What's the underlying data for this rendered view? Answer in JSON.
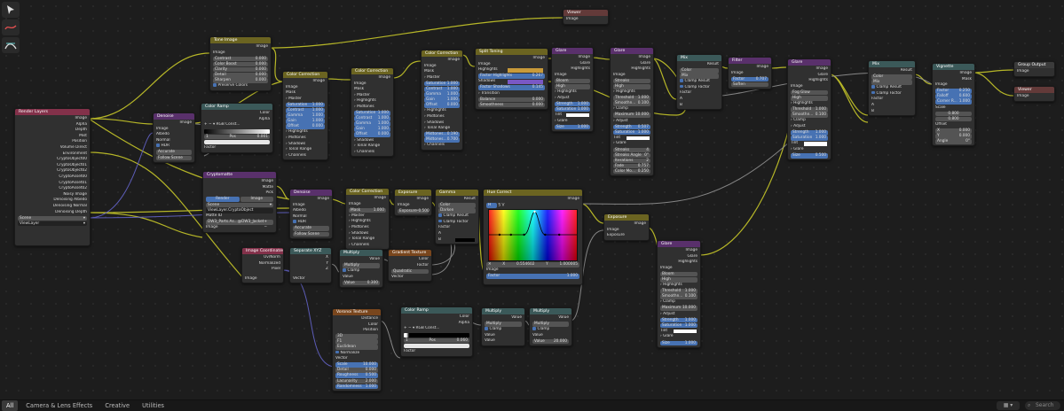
{
  "statusbar": {
    "tabs": [
      "All",
      "Camera & Lens Effects",
      "Creative",
      "Utilities"
    ],
    "layout_icon": "grid-icon",
    "search_placeholder": "Search"
  },
  "toolbar": {
    "icons": [
      "select-icon",
      "annotate-icon",
      "pan-icon"
    ]
  },
  "nodes": {
    "viewer_top": {
      "title": "Viewer",
      "image": "Image"
    },
    "tone_image": {
      "title": "Tone Image",
      "out": "Image",
      "in_image": "Image",
      "f1": "Contrast",
      "v1": "0.000",
      "f2": "Color Boost",
      "v2": "0.000",
      "f3": "Clarity",
      "v3": "0.000",
      "f4": "Detail",
      "v4": "0.000",
      "f5": "Sharpen",
      "v5": "0.000",
      "preserve": "Preserve Colors"
    },
    "render_layers": {
      "title": "Render Layers",
      "outputs": [
        "Image",
        "Alpha",
        "Depth",
        "Mist",
        "Position",
        "Volume Direct",
        "Environment",
        "CryptoObject00",
        "CryptoObject01",
        "CryptoObject02",
        "CryptoAsset00",
        "CryptoAsset01",
        "CryptoAsset02",
        "Noisy Image",
        "Denoising Albedo",
        "Denoising Normal",
        "Denoising Depth"
      ],
      "scene": "Scene",
      "viewlayer": "ViewLayer"
    },
    "denoise1": {
      "title": "Denoise",
      "out": "Image",
      "i1": "Image",
      "i2": "Albedo",
      "i3": "Normal",
      "hdr": "HDR",
      "mode": "Accurate",
      "follow": "Follow Scene"
    },
    "color_ramp1": {
      "title": "Color Ramp",
      "o1": "Color",
      "o2": "Alpha",
      "mode": "RGB",
      "interp": "Const...",
      "stop": "1",
      "pos_label": "Pos",
      "pos": "0.001",
      "factor": "Factor"
    },
    "cc1": {
      "title": "Color Correction",
      "out": "Image",
      "i1": "Image",
      "i2": "Mask",
      "master": "Master",
      "sat": "Saturation",
      "sat_v": "1.000",
      "con": "Contrast",
      "con_v": "1.000",
      "gam": "Gamma",
      "gam_v": "1.000",
      "gain": "Gain",
      "gain_v": "1.000",
      "off": "Offset",
      "off_v": "0.000",
      "subs": [
        "Highlights",
        "Midtones",
        "Shadows",
        "Tonal Range",
        "Channels"
      ]
    },
    "cc2": {
      "title": "Color Correction",
      "out": "Image",
      "i1": "Image",
      "i2": "Mask",
      "subs": [
        "Master",
        "Highlights",
        "Midtones"
      ],
      "sat": "Saturation",
      "sat_v": "1.000",
      "con": "Contrast",
      "con_v": "1.000",
      "gam": "Gamma",
      "gam_v": "1.000",
      "gain": "Gain",
      "gain_v": "1.000",
      "off": "Offset",
      "off_v": "0.000",
      "subs2": [
        "Shadows",
        "Tonal Range",
        "Channels"
      ]
    },
    "cc3": {
      "title": "Color Correction",
      "out": "Image",
      "i1": "Image",
      "i2": "Mask",
      "master": "Master",
      "sat": "Saturation",
      "sat_v": "1.000",
      "con": "Contrast",
      "con_v": "1.000",
      "gam": "Gamma",
      "gam_v": "1.000",
      "gain": "Gain",
      "gain_v": "1.000",
      "off": "Offset",
      "off_v": "0.000",
      "subs": [
        "Highlights",
        "Midtones",
        "Shadows",
        "Tonal Range"
      ],
      "mid": "Midtones...",
      "mid_v": "0.190",
      "mid2": "Midtones...",
      "mid2_v": "0.700",
      "channels": "Channels"
    },
    "split_toning": {
      "title": "Split Toning",
      "out": "Image",
      "i1": "Image",
      "hl": "Highlights",
      "factor_hl": "Factor Highlights",
      "factor_hl_v": "0.267",
      "sh": "Shadows",
      "factor_sh": "Factor Shadows",
      "factor_sh_v": "0.145",
      "trans": "Transition",
      "bal": "Balance",
      "bal_v": "0.000",
      "smooth": "Smoothness",
      "smooth_v": "0.000"
    },
    "glare1": {
      "title": "Glare",
      "o1": "Image",
      "o2": "Glare",
      "o3": "Highlights",
      "i1": "Image",
      "type": "Bloom",
      "quality": "High",
      "hl": "Highlights",
      "adjust": "Adjust",
      "str": "Strength",
      "str_v": "1.000",
      "sat": "Saturation",
      "sat_v": "1.000",
      "tint": "Tint",
      "glare": "Glare",
      "size": "Size",
      "size_v": "1.000"
    },
    "glare2": {
      "title": "Glare",
      "o1": "Image",
      "o2": "Glare",
      "o3": "Highlights",
      "i1": "Image",
      "type": "Streaks",
      "quality": "High",
      "hl": "Highlights",
      "thr": "Threshold",
      "thr_v": "1.000",
      "smooth": "Smoothn...",
      "smooth_v": "0.100",
      "clamp": "Clamp",
      "max": "Maximum",
      "max_v": "10.000",
      "adjust": "Adjust",
      "str": "Strength",
      "str_v": "0.507",
      "sat": "Saturation",
      "sat_v": "1.000",
      "tint": "Tint",
      "glare": "Glare",
      "streaks": "Streaks",
      "streaks_v": "4",
      "angle": "Streaks Angle",
      "angle_v": "0°",
      "iter": "Iterations",
      "iter_v": "2",
      "fade": "Fade",
      "fade_v": "0.757",
      "color_mod": "Color Mo...",
      "color_mod_v": "0.250"
    },
    "mix1": {
      "title": "Mix",
      "out": "Result",
      "mode": "Color",
      "blend": "Mix",
      "clamp_res": "Clamp Result",
      "clamp_f": "Clamp Factor",
      "factor": "Factor",
      "a": "A",
      "b": "B"
    },
    "filter": {
      "title": "Filter",
      "out": "Image",
      "i1": "Image",
      "factor": "Factor",
      "factor_v": "0.707",
      "type": "Soften"
    },
    "glare3": {
      "title": "Glare",
      "o1": "Image",
      "o2": "Glare",
      "o3": "Highlights",
      "i1": "Image",
      "type": "Fog Glow",
      "quality": "High",
      "hl": "Highlights",
      "thr": "Threshold",
      "thr_v": "1.000",
      "smooth": "Smoothn...",
      "smooth_v": "0.100",
      "clamp": "Clamp",
      "adjust": "Adjust",
      "str": "Strength",
      "str_v": "1.000",
      "sat": "Saturation",
      "sat_v": "1.000",
      "tint": "Tint",
      "glare": "Glare",
      "size": "Size",
      "size_v": "0.500"
    },
    "mix2": {
      "title": "Mix",
      "out": "Result",
      "mode": "Color",
      "blend": "Mix",
      "clamp_res": "Clamp Result",
      "clamp_f": "Clamp Factor",
      "factor": "Factor",
      "a": "A",
      "b": "B"
    },
    "vignette": {
      "title": "Vignette",
      "o1": "Image",
      "o2": "Mask",
      "i1": "Image",
      "factor": "Factor",
      "factor_v": "0.250",
      "falloff": "Falloff",
      "falloff_v": "0.600",
      "corner": "Corner R...",
      "corner_v": "1.000",
      "scale": "Scale",
      "sx": "0.800",
      "sy": "0.800",
      "offset": "Offset",
      "ox": "X",
      "ox_v": "0.000",
      "oy": "Y",
      "oy_v": "0.000",
      "angle": "Angle",
      "angle_v": "0°"
    },
    "group_output": {
      "title": "Group Output",
      "image": "Image"
    },
    "viewer_right": {
      "title": "Viewer",
      "image": "Image"
    },
    "cryptomatte": {
      "title": "Cryptomatte",
      "o1": "Image",
      "o2": "Matte",
      "o3": "Pick",
      "tab1": "Render",
      "tab2": "Image",
      "scene": "Scene",
      "layer": "ViewLayer.CryptoObject",
      "matte_id": "Matte ID",
      "matte_v": "DW3_Parts.As...@DW3_Jacket",
      "in": "Image"
    },
    "denoise2": {
      "title": "Denoise",
      "out": "Image",
      "i1": "Image",
      "i2": "Albedo",
      "i3": "Normal",
      "hdr": "HDR",
      "mode": "Accurate",
      "follow": "Follow Scene"
    },
    "cc4": {
      "title": "Color Correction",
      "out": "Image",
      "i1": "Image",
      "mask": "Mask",
      "mask_v": "1.000",
      "subs": [
        "Master",
        "Highlights",
        "Midtones",
        "Shadows",
        "Tonal Range",
        "Channels"
      ]
    },
    "exposure1": {
      "title": "Exposure",
      "out": "Image",
      "i1": "Image",
      "exp": "Exposure",
      "exp_v": "-0.500"
    },
    "gamma": {
      "title": "Gamma",
      "out": "Result",
      "i1": "Color",
      "mode": "Darken",
      "clamp_res": "Clamp Result",
      "clamp_f": "Clamp Factor",
      "factor": "Factor",
      "a": "A",
      "b": "B"
    },
    "hue_correct": {
      "title": "Hue Correct",
      "out": "Image",
      "h": "H",
      "s": "S",
      "v": "V",
      "x": "X",
      "x_v": "0.554602",
      "y": "Y",
      "y_v": "1.000005",
      "in": "Image",
      "factor": "Factor",
      "factor_v": "1.000"
    },
    "exposure2": {
      "title": "Exposure",
      "out": "Image",
      "i1": "Image",
      "exp": "Exposure"
    },
    "glare4": {
      "title": "Glare",
      "o1": "Image",
      "o2": "Glare",
      "o3": "Highlights",
      "i1": "Image",
      "type": "Bloom",
      "quality": "High",
      "hl": "Highlights",
      "thr": "Threshold",
      "thr_v": "1.000",
      "smooth": "Smoothn...",
      "smooth_v": "0.100",
      "clamp": "Clamp",
      "max": "Maximum",
      "max_v": "10.000",
      "adjust": "Adjust",
      "str": "Strength",
      "str_v": "1.000",
      "sat": "Saturation",
      "sat_v": "1.000",
      "tint": "Tint",
      "glare": "Glare",
      "size": "Size",
      "size_v": "1.000"
    },
    "image_coords": {
      "title": "Image Coordinates",
      "o1": "Uv/Norm",
      "o2": "Normalized",
      "o3": "Pixel",
      "in": "Image"
    },
    "sep_xyz": {
      "title": "Separate XYZ",
      "o1": "X",
      "o2": "Y",
      "o3": "Z",
      "in": "Vector"
    },
    "multiply1": {
      "title": "Multiply",
      "out": "Value",
      "op": "Multiply",
      "clamp": "Clamp",
      "val": "Value",
      "val2": "Value",
      "val2_v": "0.300"
    },
    "gradient": {
      "title": "Gradient Texture",
      "o1": "Color",
      "o2": "Factor",
      "type": "Quadratic",
      "in": "Vector"
    },
    "voronoi": {
      "title": "Voronoi Texture",
      "o1": "Distance",
      "o2": "Color",
      "o3": "Position",
      "dim": "3D",
      "feat": "F1",
      "metric": "Euclidean",
      "norm": "Normalize",
      "vec": "Vector",
      "scale": "Scale",
      "scale_v": "10.000",
      "detail": "Detail",
      "detail_v": "0.000",
      "rough": "Roughness",
      "rough_v": "0.500",
      "lac": "Lacunarity",
      "lac_v": "2.000",
      "rand": "Randomness",
      "rand_v": "1.000"
    },
    "color_ramp2": {
      "title": "Color Ramp",
      "o1": "Color",
      "o2": "Alpha",
      "mode": "RGB",
      "interp": "Const...",
      "stop": "1",
      "pos_label": "Pos",
      "pos": "0.060",
      "factor": "Factor"
    },
    "multiply2": {
      "title": "Multiply",
      "out": "Value",
      "op": "Multiply",
      "clamp": "Clamp",
      "val": "Value",
      "val2": "Value"
    },
    "multiply3": {
      "title": "Multiply",
      "out": "Value",
      "op": "Multiply",
      "clamp": "Clamp",
      "val": "Value",
      "val2": "Value",
      "val2_v": "20.000"
    }
  }
}
